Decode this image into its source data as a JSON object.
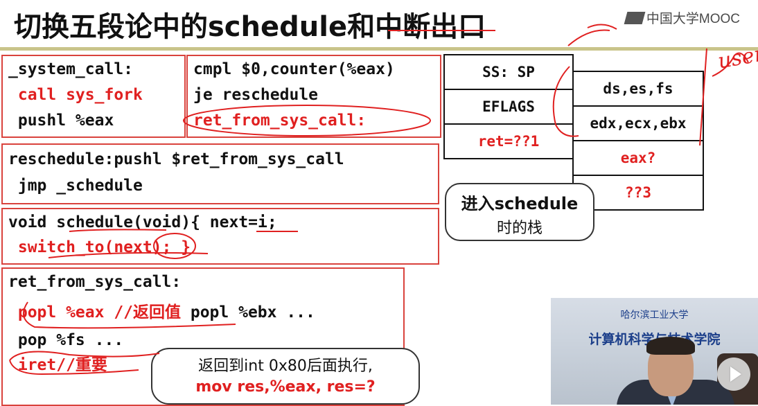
{
  "title": "切换五段论中的schedule和中断出口",
  "logo": "中国大学MOOC",
  "box1": {
    "l1": "_system_call:",
    "l2": " call sys_fork",
    "l3": " pushl %eax"
  },
  "box2": {
    "l1": "cmpl $0,counter(%eax)",
    "l2": "je reschedule",
    "l3": "ret_from_sys_call:"
  },
  "box3": {
    "l1": "reschedule:pushl $ret_from_sys_call",
    "l2": " jmp _schedule"
  },
  "box4": {
    "l1": "void schedule(void){ next=i;",
    "l2": " switch_to(next); }"
  },
  "box5": {
    "l1": "ret_from_sys_call:",
    "l2_red": " popl %eax //返回值",
    "l2_black": " popl %ebx ...",
    "l3": " pop %fs ...",
    "l4": " iret//重要"
  },
  "stack_left": [
    "SS: SP",
    "EFLAGS",
    "ret=??1"
  ],
  "stack_right": [
    "ds,es,fs",
    "edx,ecx,ebx",
    "eax?",
    "??3"
  ],
  "callout_stack": {
    "line1": "进入schedule",
    "line2": "时的栈"
  },
  "callout_ret": {
    "line1": "返回到int 0x80后面执行,",
    "line2": "mov res,%eax, res=?"
  },
  "annotation_user": "user",
  "video": {
    "school": "哈尔滨工业大学",
    "banner": "计算机科学与技术学院"
  },
  "colors": {
    "accent_red": "#e02020",
    "box_border": "#d9423c",
    "rule": "#c9c48a"
  }
}
